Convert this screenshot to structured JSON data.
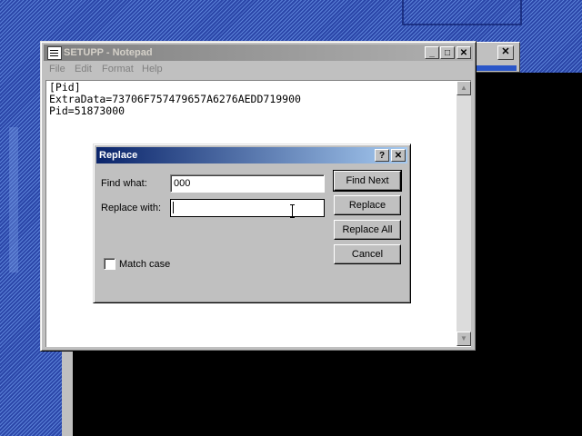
{
  "notepad": {
    "title": "SETUPP - Notepad",
    "menu": [
      "File",
      "Edit",
      "Format",
      "Help"
    ],
    "buttons": {
      "minimize": "_",
      "maximize": "□",
      "close": "✕"
    },
    "lines": [
      "[Pid]",
      "ExtraData=73706F757479657A6276AEDD719900",
      "Pid=51873000"
    ]
  },
  "background_window": {
    "close": "✕"
  },
  "replace_dialog": {
    "title": "Replace",
    "help_button": "?",
    "close_button": "✕",
    "find_label": "Find what:",
    "find_value": "000",
    "replace_label": "Replace with:",
    "replace_value": "",
    "match_case_label": "Match case",
    "match_case_checked": false,
    "buttons": {
      "find_next": "Find Next",
      "replace": "Replace",
      "replace_all": "Replace All",
      "cancel": "Cancel"
    }
  },
  "colors": {
    "dialog_title_active": "#0a246a",
    "window_title_inactive": "#808080",
    "face": "#c0c0c0",
    "desktop": "#2b46a8"
  }
}
